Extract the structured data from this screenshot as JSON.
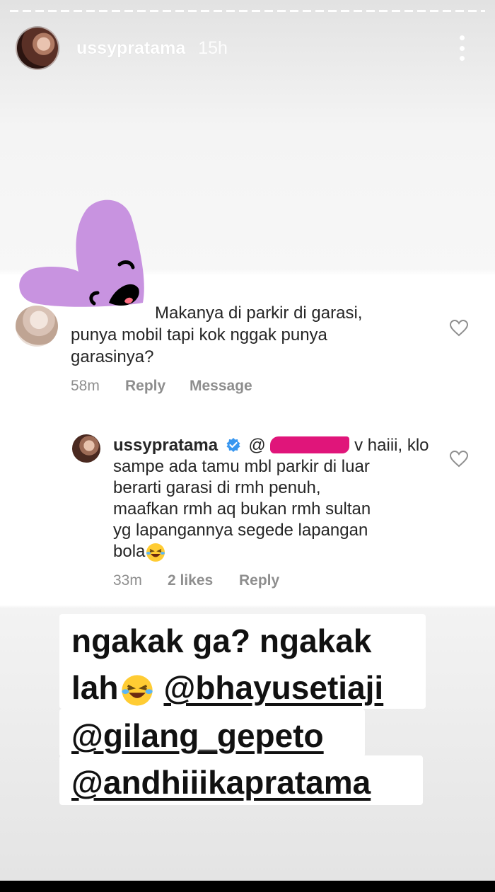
{
  "story": {
    "username": "ussypratama",
    "time": "15h"
  },
  "comment1": {
    "text_line1": "Makanya di parkir di garasi,",
    "text_line2": "punya mobil tapi kok nggak punya",
    "text_line3": "garasinya?",
    "time": "58m",
    "reply_label": "Reply",
    "message_label": "Message"
  },
  "comment2": {
    "username": "ussypratama",
    "mention_prefix": "@",
    "line1_suffix": "v haiii, klo",
    "line2": "sampe ada tamu mbl parkir di luar",
    "line3": "berarti garasi di rmh penuh,",
    "line4": "maafkan rmh aq bukan rmh sultan",
    "line5": "yg lapangannya segede lapangan",
    "line6": "bola",
    "time": "33m",
    "likes": "2 likes",
    "reply_label": "Reply"
  },
  "caption": {
    "line1": "ngakak ga? ngakak",
    "line2_text": "lah",
    "line2_mention": "@bhayusetiaji",
    "line3": "@gilang_gepeto",
    "line4": "@andhiiikapratama"
  },
  "colors": {
    "verified": "#3897f0",
    "redaction": "#e0157a",
    "sticker": "#c893e0"
  },
  "icons": [
    "more-icon",
    "heart-icon",
    "verified-icon",
    "laughing-emoji-icon",
    "heart-sticker"
  ]
}
